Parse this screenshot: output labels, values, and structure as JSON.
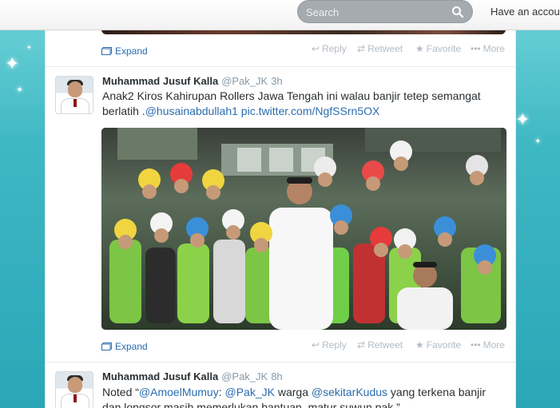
{
  "topbar": {
    "search_placeholder": "Search",
    "account_link": "Have an account?"
  },
  "actions": {
    "expand": "Expand",
    "reply": "Reply",
    "retweet": "Retweet",
    "favorite": "Favorite",
    "more": "More"
  },
  "tweets": [
    {
      "fullname": "Muhammad Jusuf Kalla",
      "username": "@Pak_JK",
      "time": "3h",
      "text_plain": "Anak2 Kiros Kahirupan Rollers Jawa Tengah ini walau banjir tetep semangat berlatih .",
      "mention": "@husainabdullah1",
      "pic_link": "pic.twitter.com/NgfSSrn5OX"
    },
    {
      "fullname": "Muhammad Jusuf Kalla",
      "username": "@Pak_JK",
      "time": "8h",
      "text_prefix": "Noted “",
      "mention1": "@AmoelMumuy",
      "colon": ": ",
      "mention2": "@Pak_JK",
      "mid": " warga ",
      "mention3": "@sekitarKudus",
      "tail": " yang terkena banjir dan longsor masih memerlukan bantuan. matur suwun pak.”"
    }
  ],
  "colors": {
    "link": "#2a6db0",
    "muted": "#b3bcc4",
    "background_teal": "#3fb8c4"
  }
}
